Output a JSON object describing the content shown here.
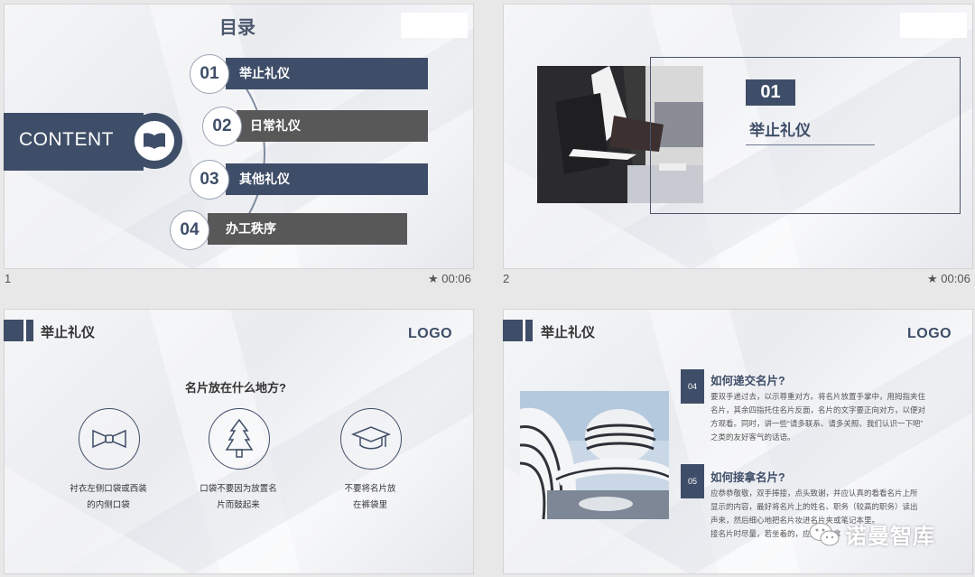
{
  "slides": [
    {
      "number": "1",
      "time": "00:06",
      "title": "目录",
      "content_label": "CONTENT",
      "items": [
        {
          "num": "01",
          "label": "举止礼仪"
        },
        {
          "num": "02",
          "label": "日常礼仪"
        },
        {
          "num": "03",
          "label": "其他礼仪"
        },
        {
          "num": "04",
          "label": "办工秩序"
        }
      ]
    },
    {
      "number": "2",
      "time": "00:06",
      "badge": "01",
      "heading": "举止礼仪"
    },
    {
      "header": "举止礼仪",
      "logo": "LOGO",
      "question": "名片放在什么地方?",
      "captions": [
        {
          "line1": "衬衣左侧口袋或西装",
          "line2": "的内侧口袋"
        },
        {
          "line1": "口袋不要因为放置名",
          "line2": "片而鼓起来"
        },
        {
          "line1": "不要将名片放",
          "line2": "在裤袋里"
        }
      ]
    },
    {
      "header": "举止礼仪",
      "logo": "LOGO",
      "sections": [
        {
          "num": "04",
          "title": "如何递交名片?",
          "lines": [
            "要双手递过去，以示尊重对方。将名片放置手掌中，用拇指夹住",
            "名片，其余四指托住名片反面，名片的文字要正向对方，以便对",
            "方观看。同时，讲一些“请多联系、请多关照、我们认识一下吧”",
            "之类的友好客气的话语。"
          ]
        },
        {
          "num": "05",
          "title": "如何接拿名片?",
          "lines": [
            "应恭恭敬敬，双手捧接，点头致谢，并应认真的看看名片上所",
            "显示的内容，最好将名片上的姓名、职务（较高的职务）读出",
            "声来，然后细心地把名片妆进名片夹或笔记本里。",
            "接名片时尽量，若坐着的，应起身接拿"
          ]
        }
      ]
    }
  ],
  "watermark": "诺曼智库"
}
